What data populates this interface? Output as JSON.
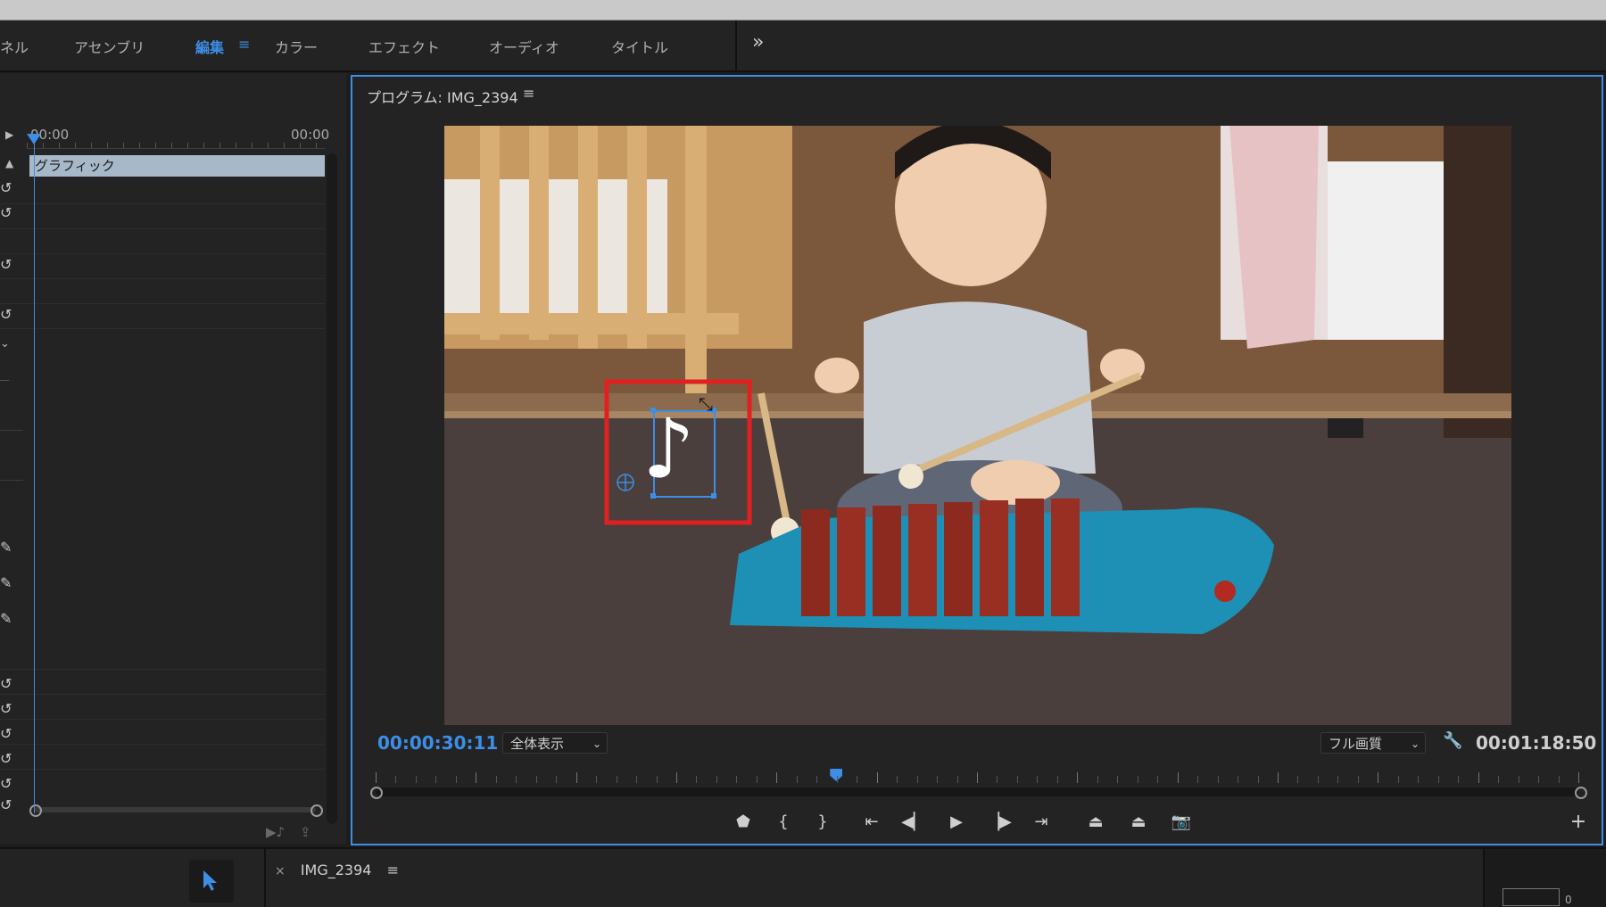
{
  "workspace_tabs": {
    "t0": "ネル",
    "t1": "アセンブリ",
    "t2": "編集",
    "t3": "カラー",
    "t4": "エフェクト",
    "t5": "オーディオ",
    "t6": "タイトル",
    "overflow": "»",
    "active_menu": "≡"
  },
  "left_panel": {
    "ruler_start": "00:00",
    "ruler_end": "00:00",
    "clip_label": "グラフィック"
  },
  "monitor": {
    "title": "プログラム: IMG_2394",
    "menu": "≡",
    "timecode_current": "00:00:30:11",
    "zoom_select": "全体表示",
    "quality_select": "フル画質",
    "timecode_duration": "00:01:18:50",
    "playhead_fraction": 0.383
  },
  "graphic": {
    "glyph": "♪"
  },
  "colors": {
    "accent": "#3d8ee6",
    "highlight_box": "#e32020",
    "clip_fill": "#a7b8c9"
  },
  "bottom": {
    "sequence_close": "×",
    "sequence_name": "IMG_2394",
    "sequence_menu": "≡",
    "corner_value": "0"
  }
}
